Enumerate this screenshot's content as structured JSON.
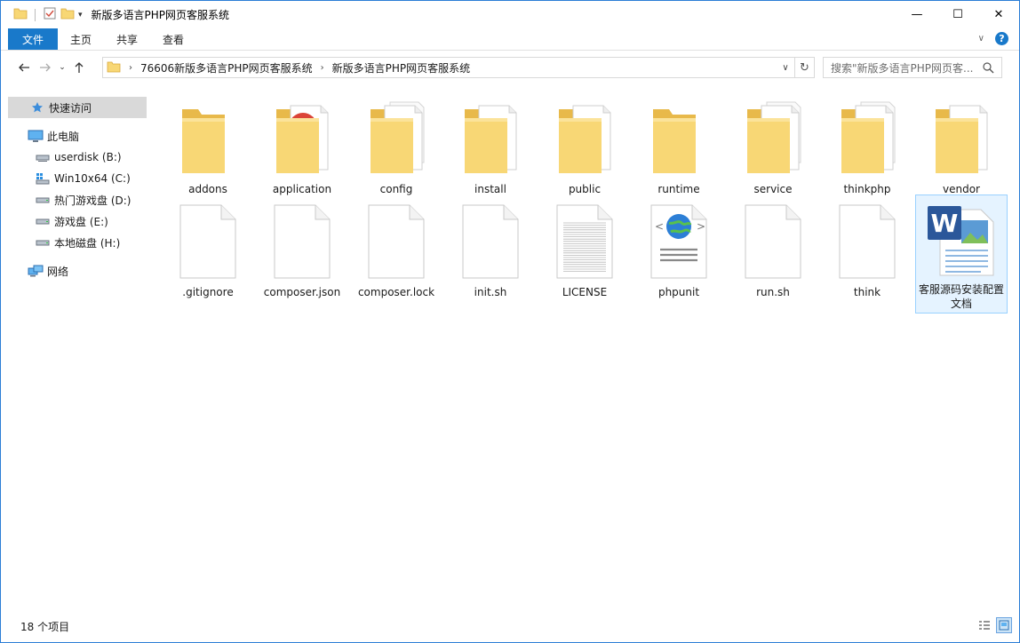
{
  "window": {
    "title": "新版多语言PHP网页客服系统",
    "minimize": "—",
    "maximize": "☐",
    "close": "✕"
  },
  "ribbon": {
    "tabs": [
      "文件",
      "主页",
      "共享",
      "查看"
    ]
  },
  "address": {
    "crumbs": [
      "76606新版多语言PHP网页客服系统",
      "新版多语言PHP网页客服系统"
    ],
    "search_placeholder": "搜索\"新版多语言PHP网页客..."
  },
  "sidebar": {
    "quick_access": "快速访问",
    "this_pc": "此电脑",
    "drives": [
      {
        "label": "userdisk (B:)",
        "icon": "network-drive-icon"
      },
      {
        "label": "Win10x64 (C:)",
        "icon": "windows-drive-icon"
      },
      {
        "label": "热门游戏盘 (D:)",
        "icon": "drive-icon"
      },
      {
        "label": "游戏盘 (E:)",
        "icon": "drive-icon"
      },
      {
        "label": "本地磁盘 (H:)",
        "icon": "drive-icon"
      }
    ],
    "network": "网络"
  },
  "files": [
    {
      "name": "addons",
      "type": "folder"
    },
    {
      "name": "application",
      "type": "folder-chrome"
    },
    {
      "name": "config",
      "type": "folder-docs"
    },
    {
      "name": "install",
      "type": "folder-doc"
    },
    {
      "name": "public",
      "type": "folder-doc"
    },
    {
      "name": "runtime",
      "type": "folder"
    },
    {
      "name": "service",
      "type": "folder-docs"
    },
    {
      "name": "thinkphp",
      "type": "folder-docs"
    },
    {
      "name": "vendor",
      "type": "folder-doc"
    },
    {
      "name": ".gitignore",
      "type": "file"
    },
    {
      "name": "composer.json",
      "type": "file"
    },
    {
      "name": "composer.lock",
      "type": "file"
    },
    {
      "name": "init.sh",
      "type": "file"
    },
    {
      "name": "LICENSE",
      "type": "file-lines"
    },
    {
      "name": "phpunit",
      "type": "file-web"
    },
    {
      "name": "run.sh",
      "type": "file"
    },
    {
      "name": "think",
      "type": "file"
    },
    {
      "name": "客服源码安装配置文档",
      "type": "file-word"
    }
  ],
  "status": {
    "count": "18 个项目"
  },
  "colors": {
    "accent": "#1979ca",
    "folder": "#f8d775",
    "folder_dark": "#e8b94a",
    "selection": "#e5f3ff"
  }
}
